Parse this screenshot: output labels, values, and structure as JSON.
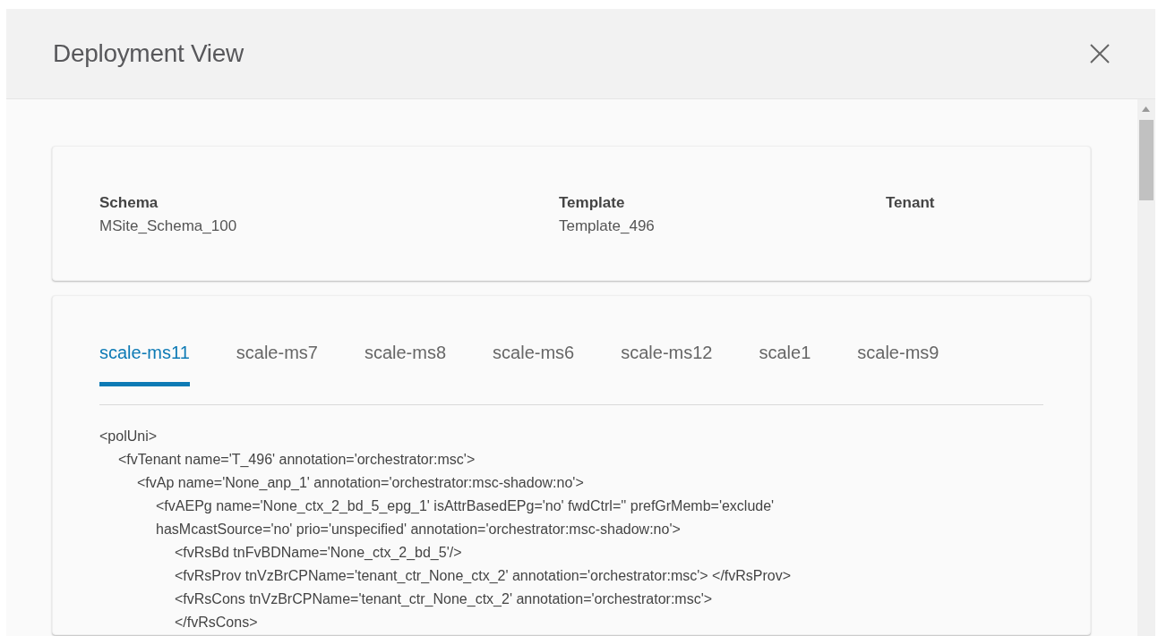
{
  "dialog": {
    "title": "Deployment View"
  },
  "summary": [
    {
      "label": "Schema",
      "value": "MSite_Schema_100"
    },
    {
      "label": "Template",
      "value": "Template_496"
    },
    {
      "label": "Tenant"
    }
  ],
  "tabs": [
    {
      "label": "scale-ms11",
      "selected": true
    },
    {
      "label": "scale-ms7",
      "selected": false
    },
    {
      "label": "scale-ms8",
      "selected": false
    },
    {
      "label": "scale-ms6",
      "selected": false
    },
    {
      "label": "scale-ms12",
      "selected": false
    },
    {
      "label": "scale1",
      "selected": false
    },
    {
      "label": "scale-ms9",
      "selected": false
    }
  ],
  "code": [
    {
      "lines": [
        "<polUni>"
      ],
      "children": [
        {
          "lines": [
            "<fvTenant name='T_496' annotation='orchestrator:msc'>"
          ],
          "children": [
            {
              "lines": [
                "<fvAp name='None_anp_1' annotation='orchestrator:msc-shadow:no'>"
              ],
              "children": [
                {
                  "lines": [
                    "<fvAEPg name='None_ctx_2_bd_5_epg_1' isAttrBasedEPg='no' fwdCtrl='' prefGrMemb='exclude'",
                    "hasMcastSource='no' prio='unspecified' annotation='orchestrator:msc-shadow:no'>"
                  ],
                  "children": [
                    {
                      "lines": [
                        "<fvRsBd tnFvBDName='None_ctx_2_bd_5'/>"
                      ]
                    },
                    {
                      "lines": [
                        "<fvRsProv tnVzBrCPName='tenant_ctr_None_ctx_2' annotation='orchestrator:msc'> </fvRsProv>"
                      ]
                    },
                    {
                      "lines": [
                        "<fvRsCons tnVzBrCPName='tenant_ctr_None_ctx_2' annotation='orchestrator:msc'>"
                      ]
                    },
                    {
                      "lines": [
                        "</fvRsCons>"
                      ]
                    }
                  ]
                }
              ]
            }
          ]
        }
      ]
    }
  ]
}
